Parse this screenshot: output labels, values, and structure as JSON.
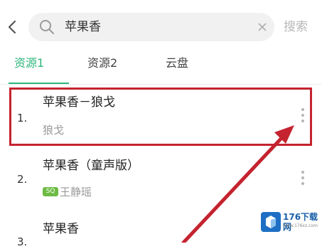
{
  "header": {
    "query": "苹果香",
    "search_label": "搜索"
  },
  "tabs": [
    {
      "label": "资源1",
      "active": true
    },
    {
      "label": "资源2",
      "active": false
    },
    {
      "label": "云盘",
      "active": false
    }
  ],
  "results": [
    {
      "index": "1.",
      "title": "苹果香－狼戈",
      "artist": "狼戈"
    },
    {
      "index": "2.",
      "title": "苹果香（童声版）",
      "artist": "王静瑶",
      "badge": "SQ"
    },
    {
      "index": "3.",
      "title": "苹果香"
    }
  ],
  "watermark": {
    "title": "176下载网",
    "sub": "www.176xz.com"
  },
  "colors": {
    "accent": "#2eb67d",
    "highlight": "#c4232f",
    "sq_badge": "#6dbb44"
  }
}
